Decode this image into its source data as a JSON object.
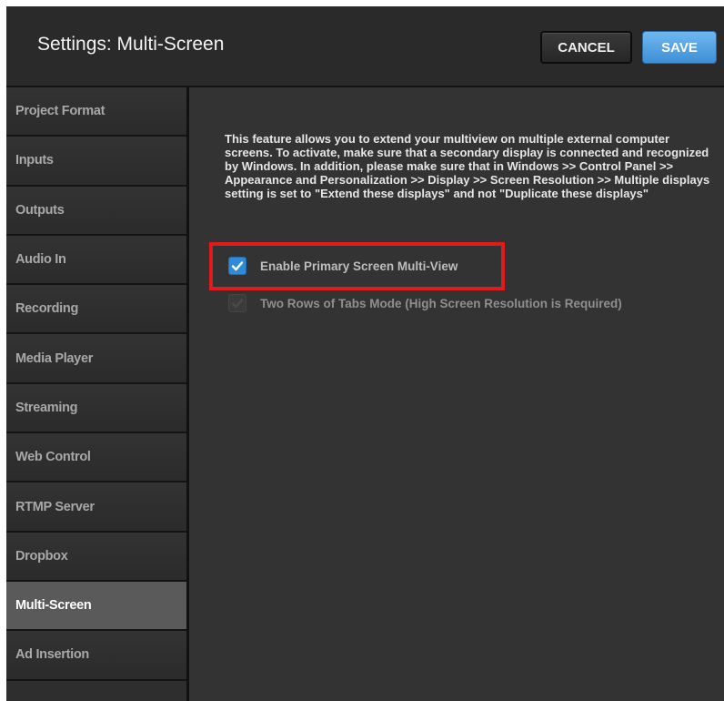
{
  "header": {
    "title": "Settings: Multi-Screen",
    "cancel_label": "CANCEL",
    "save_label": "SAVE"
  },
  "sidebar": {
    "items": [
      {
        "label": "Project Format",
        "active": false
      },
      {
        "label": "Inputs",
        "active": false
      },
      {
        "label": "Outputs",
        "active": false
      },
      {
        "label": "Audio In",
        "active": false
      },
      {
        "label": "Recording",
        "active": false
      },
      {
        "label": "Media Player",
        "active": false
      },
      {
        "label": "Streaming",
        "active": false
      },
      {
        "label": "Web Control",
        "active": false
      },
      {
        "label": "RTMP Server",
        "active": false
      },
      {
        "label": "Dropbox",
        "active": false
      },
      {
        "label": "Multi-Screen",
        "active": true
      },
      {
        "label": "Ad Insertion",
        "active": false
      }
    ]
  },
  "content": {
    "description": "This feature allows you to extend your multiview on multiple external computer screens. To activate, make sure that a secondary display is connected and recognized by Windows. In addition, please make sure that in Windows >> Control Panel >> Appearance and Personalization >> Display >> Screen Resolution >> Multiple displays setting is set to \"Extend these displays\" and not \"Duplicate these displays\"",
    "options": [
      {
        "label": "Enable Primary Screen Multi-View",
        "checked": true,
        "enabled": true,
        "highlighted": true
      },
      {
        "label": "Two Rows of Tabs Mode (High Screen Resolution is Required)",
        "checked": false,
        "enabled": false,
        "highlighted": false
      }
    ]
  },
  "colors": {
    "accent": "#2f8bd8",
    "save_button": "#4a9be0",
    "highlight_box": "#e01b1b",
    "active_tab": "#5a5a5a"
  },
  "icons": {
    "checkmark": "checkmark-icon"
  }
}
